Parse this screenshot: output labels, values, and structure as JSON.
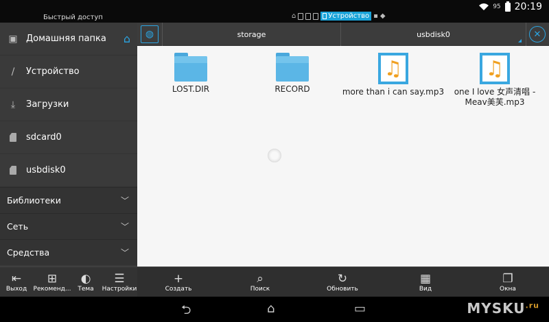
{
  "statusbar": {
    "quick_access": "Быстрый доступ",
    "active_tab": "Устройство",
    "battery": "95",
    "time": "20:19"
  },
  "sidebar": {
    "items": [
      {
        "label": "Домашняя папка",
        "icon": "home-folder-icon"
      },
      {
        "label": "Устройство",
        "icon": "device-icon"
      },
      {
        "label": "Загрузки",
        "icon": "download-icon"
      },
      {
        "label": "sdcard0",
        "icon": "sdcard-icon"
      },
      {
        "label": "usbdisk0",
        "icon": "sdcard-icon"
      }
    ],
    "sections": [
      {
        "label": "Библиотеки"
      },
      {
        "label": "Сеть"
      },
      {
        "label": "Средства"
      }
    ]
  },
  "path": {
    "segment1": "storage",
    "segment2": "usbdisk0"
  },
  "files": [
    {
      "name": "LOST.DIR",
      "type": "folder"
    },
    {
      "name": "RECORD",
      "type": "folder"
    },
    {
      "name": "more than i can say.mp3",
      "type": "mp3"
    },
    {
      "name": "one I love 女声清唱 - Meav美芙.mp3",
      "type": "mp3"
    }
  ],
  "toolbar_left": [
    {
      "label": "Выход",
      "icon": "exit-icon"
    },
    {
      "label": "Рекоменд...",
      "icon": "gift-icon"
    },
    {
      "label": "Тема",
      "icon": "palette-icon"
    },
    {
      "label": "Настройки",
      "icon": "settings-icon"
    }
  ],
  "toolbar_right": [
    {
      "label": "Создать",
      "icon": "plus-icon"
    },
    {
      "label": "Поиск",
      "icon": "search-icon"
    },
    {
      "label": "Обновить",
      "icon": "refresh-icon"
    },
    {
      "label": "Вид",
      "icon": "grid-icon"
    },
    {
      "label": "Окна",
      "icon": "windows-icon"
    }
  ],
  "watermark": {
    "main": "MYSKU",
    "sup": ".ru"
  },
  "colors": {
    "accent": "#2ba5e3",
    "sidebar": "#3a3a3a",
    "content": "#f6f6f6"
  }
}
